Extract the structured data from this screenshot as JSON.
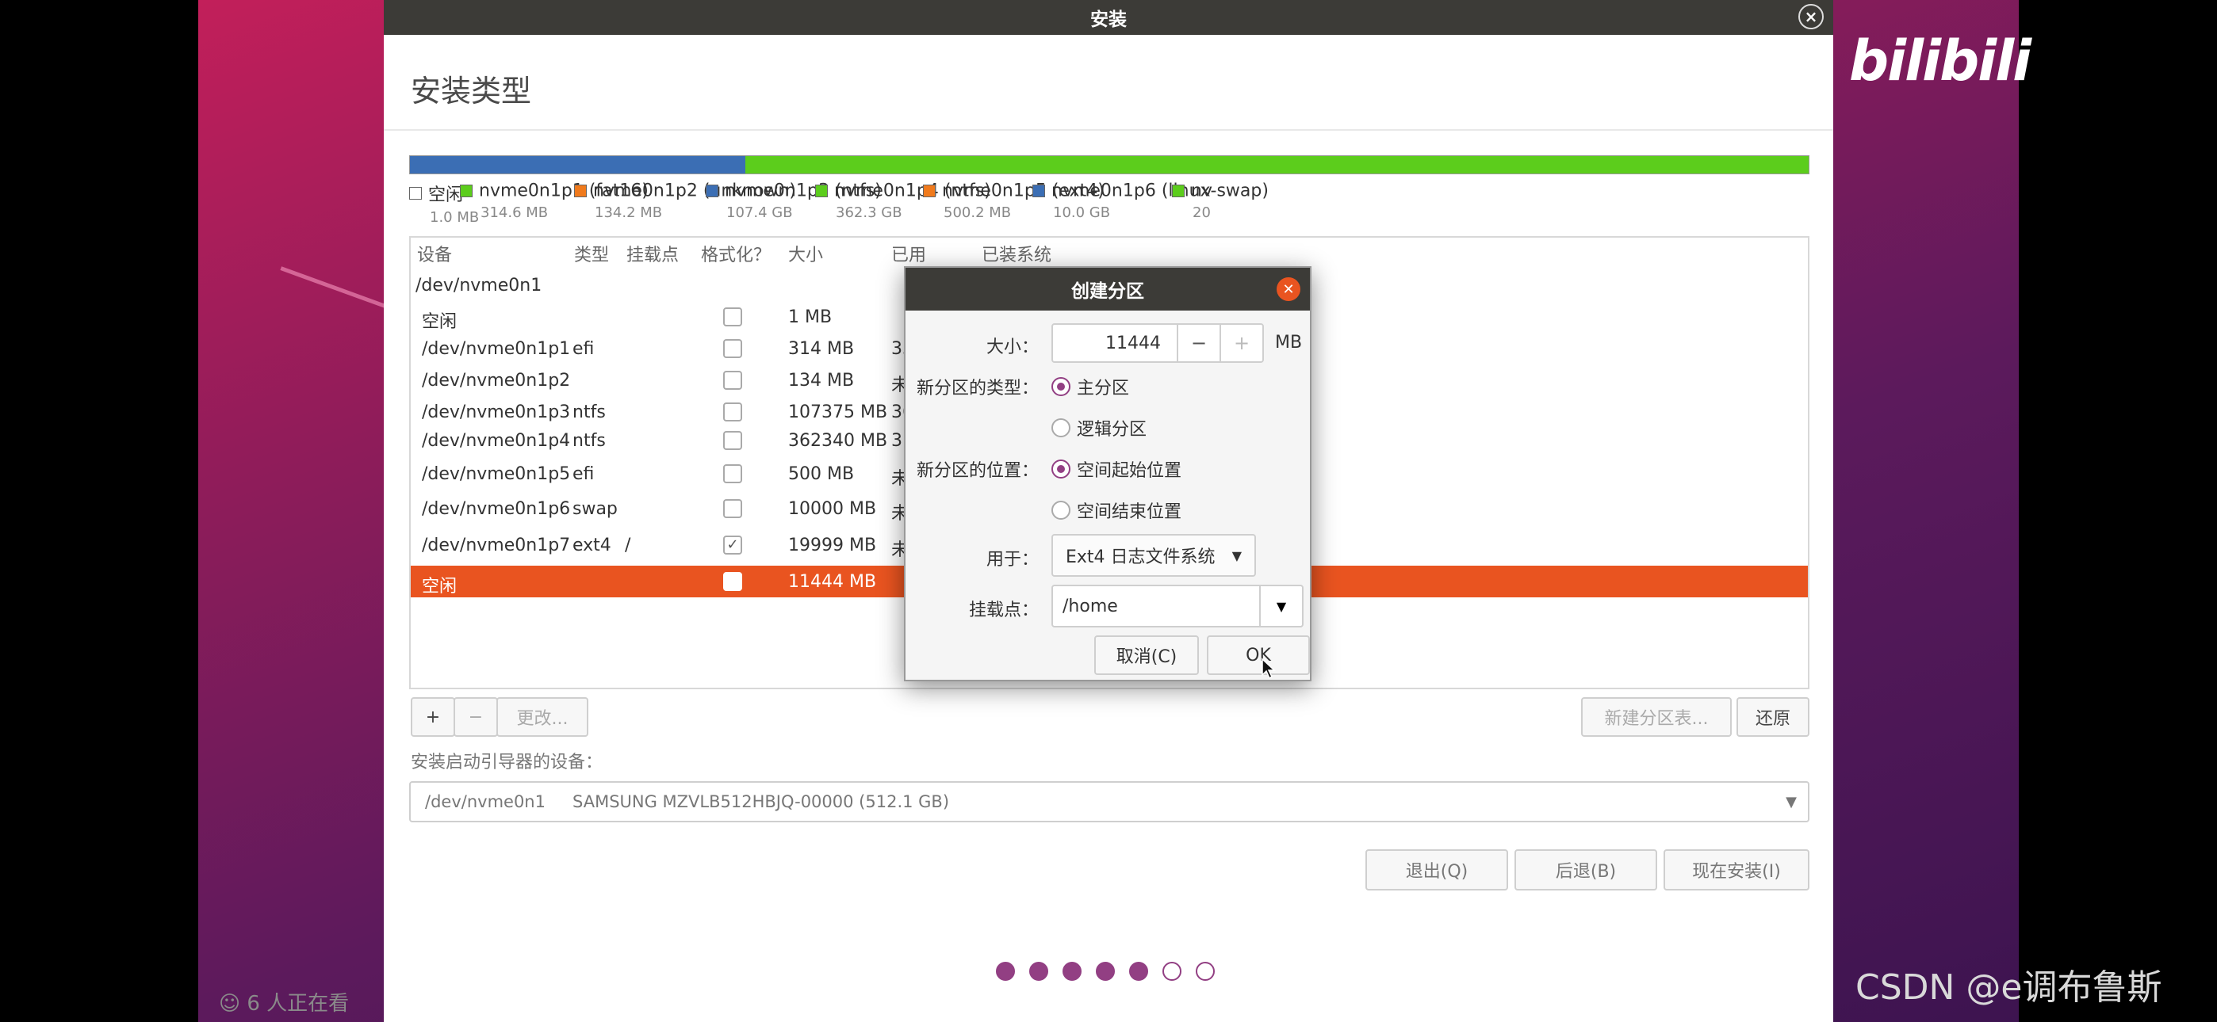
{
  "window": {
    "title": "安装",
    "close_glyph": "×"
  },
  "page": {
    "title": "安装类型"
  },
  "partition_bar": [
    {
      "color": "#3b6eb4",
      "flex": 24
    },
    {
      "color": "#5ccd1c",
      "flex": 76
    }
  ],
  "legend": [
    {
      "name": "空闲",
      "size": "1.0 MB",
      "color": "#ffffff"
    },
    {
      "name": "nvme0n1p1 (fat16)",
      "size": "314.6 MB",
      "color": "#5ccd1c"
    },
    {
      "name": "nvme0n1p2 (unknown)",
      "size": "134.2 MB",
      "color": "#f07a1c"
    },
    {
      "name": "nvme0n1p3 (ntfs)",
      "size": "107.4 GB",
      "color": "#3b6eb4"
    },
    {
      "name": "nvme0n1p4 (ntfs)",
      "size": "362.3 GB",
      "color": "#5ccd1c"
    },
    {
      "name": "nvme0n1p5 (ext4)",
      "size": "500.2 MB",
      "color": "#f07a1c"
    },
    {
      "name": "nvme0n1p6 (linux-swap)",
      "size": "10.0 GB",
      "color": "#3b6eb4"
    },
    {
      "name": "nv",
      "size": "20",
      "color": "#5ccd1c"
    }
  ],
  "table": {
    "headers": [
      "设备",
      "类型",
      "挂载点",
      "格式化？",
      "大小",
      "已用",
      "已装系统"
    ],
    "disk": "/dev/nvme0n1",
    "rows": [
      {
        "device": "空闲",
        "type": "",
        "mount": "",
        "format": false,
        "size": "1 MB",
        "used": "",
        "selected": false
      },
      {
        "device": "/dev/nvme0n1p1",
        "type": "efi",
        "mount": "",
        "format": false,
        "size": "314 MB",
        "used": "33",
        "selected": false
      },
      {
        "device": "/dev/nvme0n1p2",
        "type": "",
        "mount": "",
        "format": false,
        "size": "134 MB",
        "used": "未",
        "selected": false
      },
      {
        "device": "/dev/nvme0n1p3",
        "type": "ntfs",
        "mount": "",
        "format": false,
        "size": "107375 MB",
        "used": "36",
        "selected": false
      },
      {
        "device": "/dev/nvme0n1p4",
        "type": "ntfs",
        "mount": "",
        "format": false,
        "size": "362340 MB",
        "used": "31",
        "selected": false
      },
      {
        "device": "/dev/nvme0n1p5",
        "type": "efi",
        "mount": "",
        "format": false,
        "size": "500 MB",
        "used": "未",
        "selected": false
      },
      {
        "device": "/dev/nvme0n1p6",
        "type": "swap",
        "mount": "",
        "format": false,
        "size": "10000 MB",
        "used": "未",
        "selected": false
      },
      {
        "device": "/dev/nvme0n1p7",
        "type": "ext4",
        "mount": "/",
        "format": true,
        "size": "19999 MB",
        "used": "未",
        "selected": false
      },
      {
        "device": "空闲",
        "type": "",
        "mount": "",
        "format": false,
        "size": "11444 MB",
        "used": "",
        "selected": true
      }
    ]
  },
  "toolbar": {
    "add": "+",
    "remove": "−",
    "change": "更改...",
    "new_table": "新建分区表...",
    "revert": "还原"
  },
  "boot": {
    "label": "安装启动引导器的设备：",
    "device": "/dev/nvme0n1",
    "model": "SAMSUNG MZVLB512HBJQ-00000 (512.1 GB)",
    "arrow": "▼"
  },
  "nav": {
    "quit": "退出(Q)",
    "back": "后退(B)",
    "install": "现在安装(I)"
  },
  "progress": {
    "total": 7,
    "done": 5,
    "color": "#923f83"
  },
  "dialog": {
    "title": "创建分区",
    "close_glyph": "✕",
    "size_label": "大小：",
    "size_value": "11444",
    "minus": "−",
    "plus": "+",
    "unit": "MB",
    "type_label": "新分区的类型：",
    "type_primary": "主分区",
    "type_logical": "逻辑分区",
    "location_label": "新分区的位置：",
    "location_begin": "空间起始位置",
    "location_end": "空间结束位置",
    "use_label": "用于：",
    "use_value": "Ext4 日志文件系统",
    "mount_label": "挂载点：",
    "mount_value": "/home",
    "cancel": "取消(C)",
    "ok": "OK",
    "dropdown_glyph": "▼"
  },
  "overlay": {
    "brand": "bilibili",
    "viewers": "6 人正在看",
    "watermark": "CSDN @e调布鲁斯"
  }
}
